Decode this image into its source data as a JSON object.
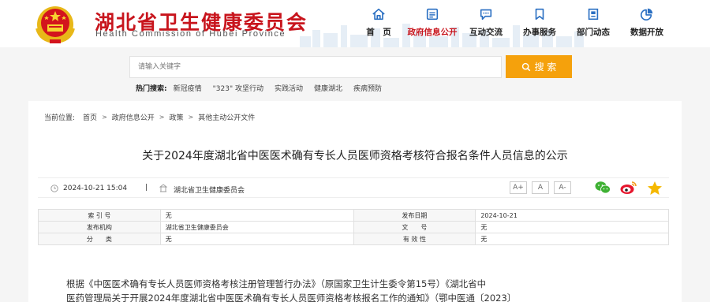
{
  "header": {
    "title": "湖北省卫生健康委员会",
    "subtitle": "Health Commission of Hubei Province",
    "brand_red": "#c8151d"
  },
  "nav": [
    {
      "label": "首　页",
      "icon": "home-icon"
    },
    {
      "label": "政府信息公开",
      "icon": "document-list-icon",
      "active": true
    },
    {
      "label": "互动交流",
      "icon": "chat-bubble-icon"
    },
    {
      "label": "办事服务",
      "icon": "bookmark-icon"
    },
    {
      "label": "部门动态",
      "icon": "news-icon"
    },
    {
      "label": "数据开放",
      "icon": "pie-chart-icon"
    }
  ],
  "search": {
    "placeholder": "请输入关键字",
    "button_label": "搜 索",
    "button_color": "#f5a10c"
  },
  "hot": {
    "label": "热门搜索:",
    "items": [
      "新冠疫情",
      "\"323\" 攻坚行动",
      "实践活动",
      "健康湖北",
      "疾病预防"
    ]
  },
  "breadcrumb": {
    "label": "当前位置:",
    "items": [
      "首页",
      "政府信息公开",
      "政策",
      "其他主动公开文件"
    ]
  },
  "article": {
    "title": "关于2024年度湖北省中医医术确有专长人员医师资格考核符合报名条件人员信息的公示",
    "date": "2024-10-21 15:04",
    "source": "湖北省卫生健康委员会",
    "font_sizes": [
      "A+",
      "A",
      "A-"
    ],
    "share_icons": [
      "wechat-icon",
      "weibo-icon",
      "favorite-star-icon"
    ]
  },
  "info_table": [
    {
      "k1": "索 引 号",
      "v1": "无",
      "k2": "发布日期",
      "v2": "2024-10-21"
    },
    {
      "k1": "发布机构",
      "v1": "湖北省卫生健康委员会",
      "k2": "文　　号",
      "v2": "无"
    },
    {
      "k1": "分　　类",
      "v1": "无",
      "k2": "有 效 性",
      "v2": "无"
    }
  ],
  "body": {
    "line1": "根据《中医医术确有专长人员医师资格考核注册管理暂行办法》（原国家卫生计生委令第15号）《湖北省中",
    "line2": "医药管理局关于开展2024年度湖北省中医医术确有专长人员医师资格考核报名工作的通知》（鄂中医通〔2023〕"
  }
}
